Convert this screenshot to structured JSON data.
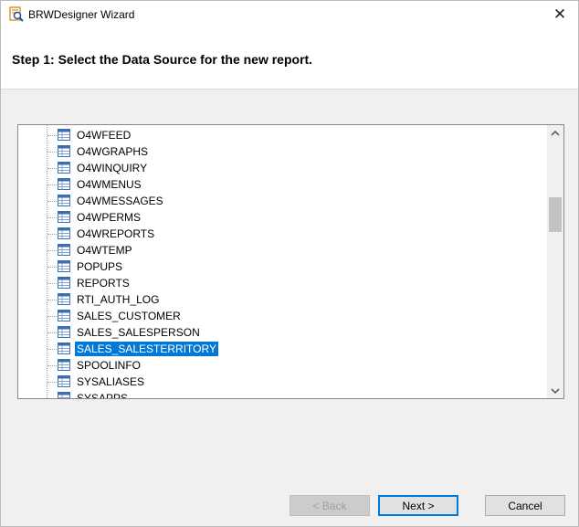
{
  "window": {
    "title": "BRWDesigner Wizard",
    "close_glyph": "✕",
    "icons": [
      "app-icon",
      "close-icon"
    ]
  },
  "header": {
    "step_title": "Step 1: Select the Data Source for the new report."
  },
  "tree": {
    "items": [
      {
        "label": "O4WFEED",
        "selected": false
      },
      {
        "label": "O4WGRAPHS",
        "selected": false
      },
      {
        "label": "O4WINQUIRY",
        "selected": false
      },
      {
        "label": "O4WMENUS",
        "selected": false
      },
      {
        "label": "O4WMESSAGES",
        "selected": false
      },
      {
        "label": "O4WPERMS",
        "selected": false
      },
      {
        "label": "O4WREPORTS",
        "selected": false
      },
      {
        "label": "O4WTEMP",
        "selected": false
      },
      {
        "label": "POPUPS",
        "selected": false
      },
      {
        "label": "REPORTS",
        "selected": false
      },
      {
        "label": "RTI_AUTH_LOG",
        "selected": false
      },
      {
        "label": "SALES_CUSTOMER",
        "selected": false
      },
      {
        "label": "SALES_SALESPERSON",
        "selected": false
      },
      {
        "label": "SALES_SALESTERRITORY",
        "selected": true
      },
      {
        "label": "SPOOLINFO",
        "selected": false
      },
      {
        "label": "SYSALIASES",
        "selected": false
      },
      {
        "label": "SYSAPPS",
        "selected": false
      }
    ],
    "item_icon": "table-icon",
    "selection_color": "#0078d7"
  },
  "buttons": {
    "back": "< Back",
    "next": "Next >",
    "cancel": "Cancel"
  }
}
